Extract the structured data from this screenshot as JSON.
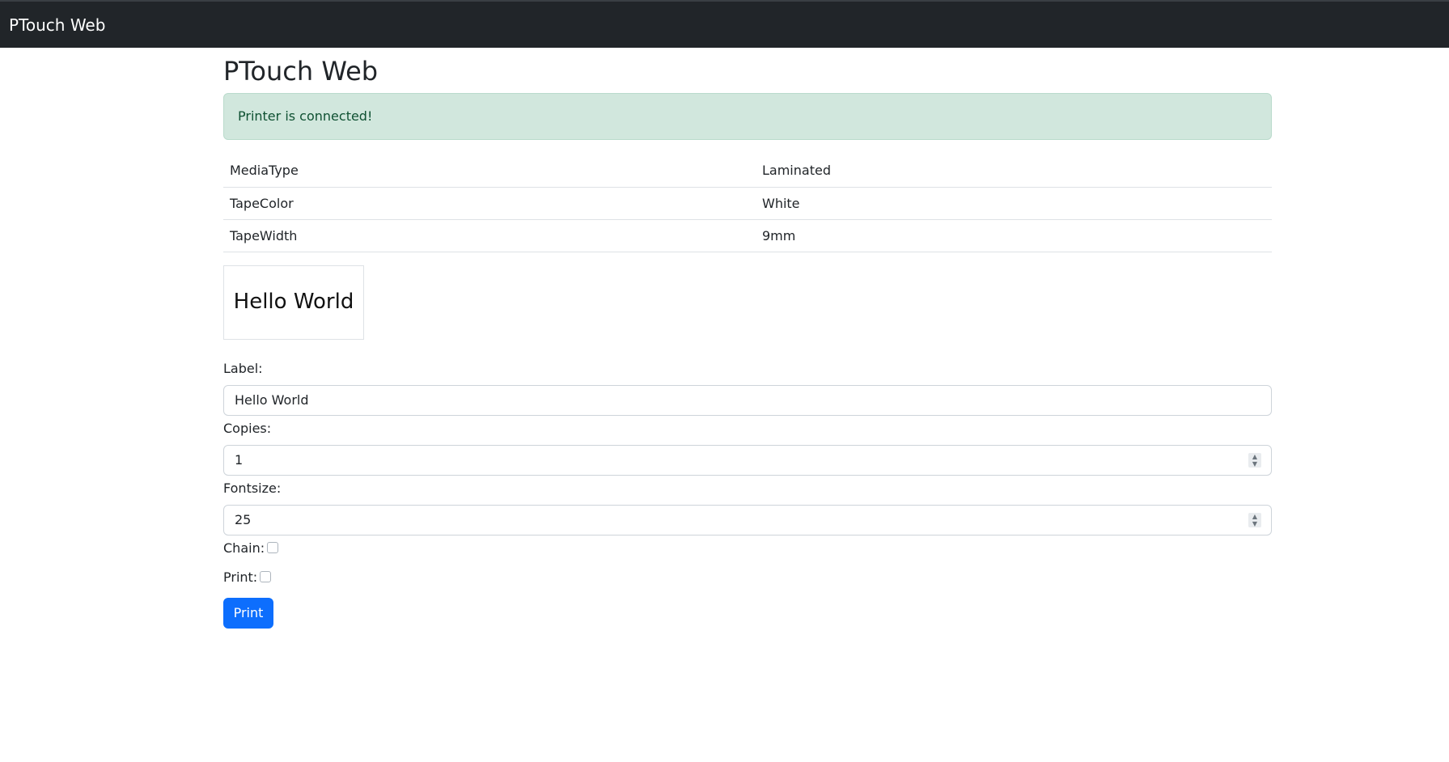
{
  "navbar": {
    "brand": "PTouch Web"
  },
  "page": {
    "title": "PTouch Web"
  },
  "alert": {
    "message": "Printer is connected!"
  },
  "printer_info": [
    {
      "key": "MediaType",
      "value": "Laminated"
    },
    {
      "key": "TapeColor",
      "value": "White"
    },
    {
      "key": "TapeWidth",
      "value": "9mm"
    }
  ],
  "preview": {
    "text": "Hello World"
  },
  "form": {
    "label_label": "Label:",
    "label_value": "Hello World",
    "copies_label": "Copies:",
    "copies_value": "1",
    "fontsize_label": "Fontsize:",
    "fontsize_value": "25",
    "chain_label": "Chain:",
    "print_label": "Print:",
    "submit_label": "Print"
  },
  "colors": {
    "navbar_bg": "#212529",
    "alert_bg": "#d1e7dd",
    "alert_text": "#0f5132",
    "primary": "#0d6efd"
  }
}
